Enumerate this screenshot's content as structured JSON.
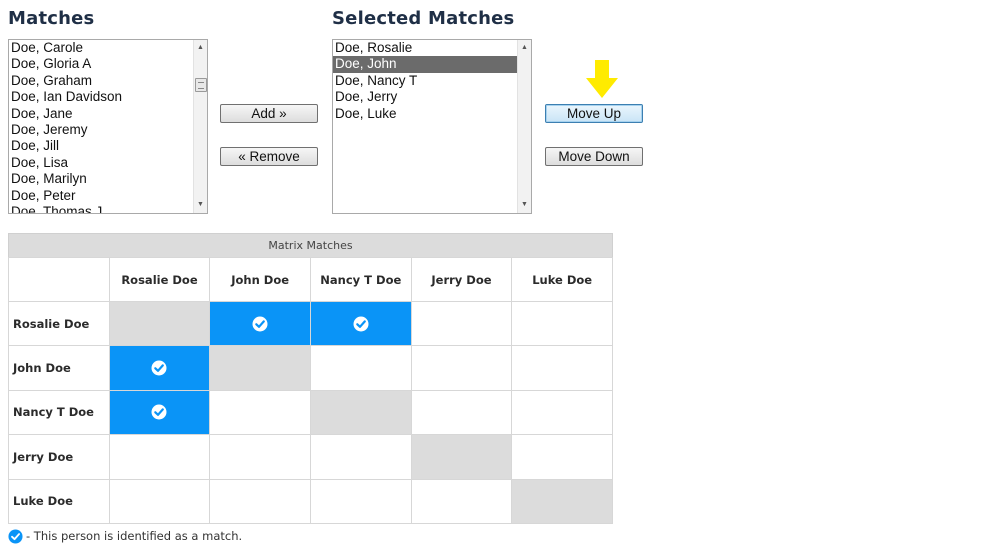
{
  "matches": {
    "title": "Matches",
    "items": [
      "Doe, Carole",
      "Doe, Gloria A",
      "Doe, Graham",
      "Doe, Ian Davidson",
      "Doe, Jane",
      "Doe, Jeremy",
      "Doe, Jill",
      "Doe, Lisa",
      "Doe, Marilyn",
      "Doe, Peter",
      "Doe, Thomas J"
    ]
  },
  "selected_matches": {
    "title": "Selected Matches",
    "items": [
      "Doe, Rosalie",
      "Doe, John",
      "Doe, Nancy T",
      "Doe, Jerry",
      "Doe, Luke"
    ],
    "selected_item": "Doe, John"
  },
  "buttons": {
    "add": "Add »",
    "remove": "« Remove",
    "move_up": "Move Up",
    "move_down": "Move Down"
  },
  "matrix": {
    "caption": "Matrix Matches",
    "people": [
      "Rosalie Doe",
      "John Doe",
      "Nancy T Doe",
      "Jerry Doe",
      "Luke Doe"
    ],
    "matches": [
      [
        false,
        true,
        true,
        false,
        false
      ],
      [
        true,
        false,
        false,
        false,
        false
      ],
      [
        true,
        false,
        false,
        false,
        false
      ],
      [
        false,
        false,
        false,
        false,
        false
      ],
      [
        false,
        false,
        false,
        false,
        false
      ]
    ]
  },
  "legend": {
    "text": "- This person is identified as a match."
  },
  "colors": {
    "match_cell": "#0a94f7",
    "diagonal_cell": "#dcdcdc",
    "indicator_arrow": "#ffeb00",
    "selected_item_bg": "#6b6b6b"
  },
  "icons": {
    "match": "check-circle-icon",
    "indicator": "arrow-down-icon"
  }
}
